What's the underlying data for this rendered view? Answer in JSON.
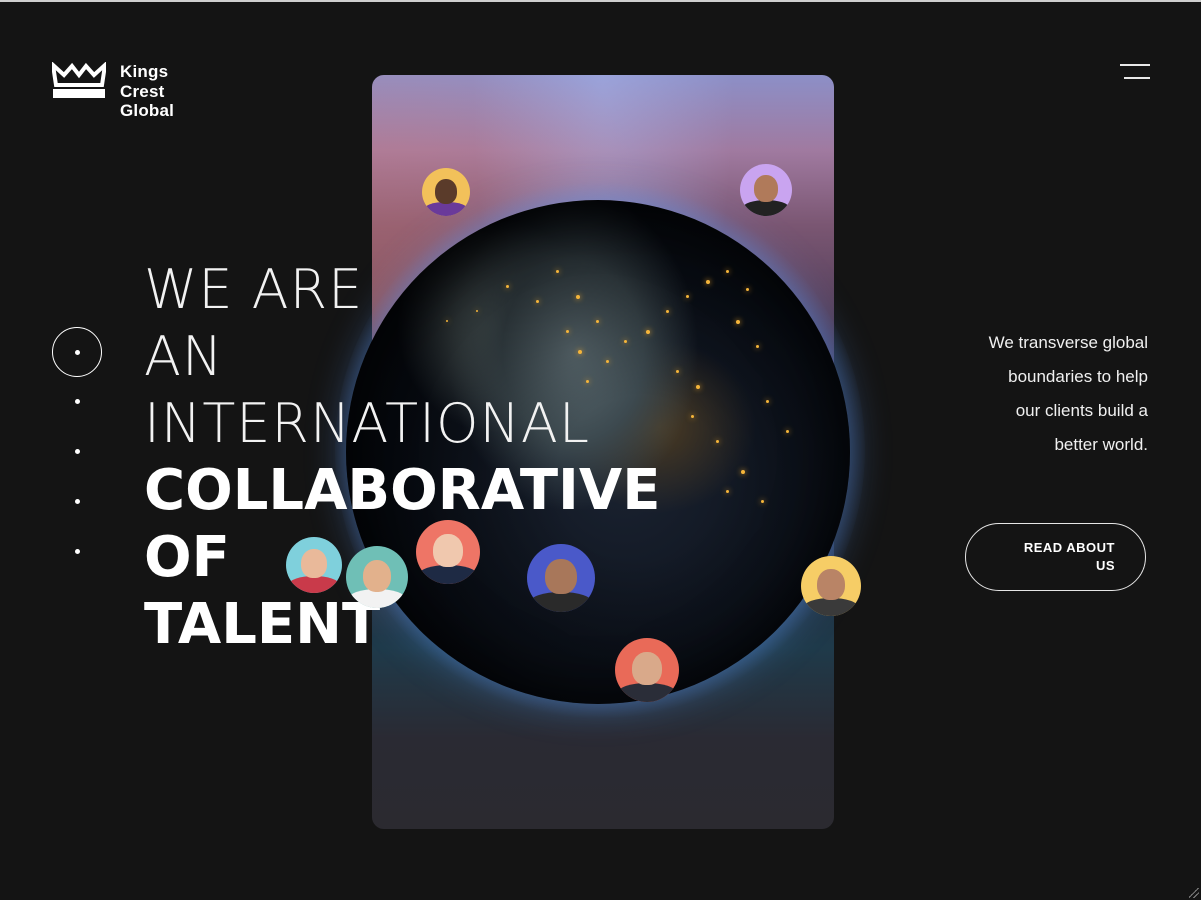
{
  "brand": {
    "name_line1": "Kings",
    "name_line2": "Crest",
    "name_line3": "Global"
  },
  "hero": {
    "line1": "WE ARE",
    "line2": "AN",
    "line3": "INTERNATIONAL",
    "line4": "COLLABORATIVE",
    "line5": "OF",
    "line6": "TALENT"
  },
  "side": {
    "tagline_1": "We transverse global",
    "tagline_2": "boundaries to help",
    "tagline_3": "our clients build a",
    "tagline_4": "better world.",
    "cta_label": "READ ABOUT US"
  },
  "pager": {
    "total": 5,
    "active_index": 0
  },
  "icons": {
    "logo": "crown-icon",
    "menu": "hamburger-menu-icon"
  },
  "colors": {
    "background": "#141414",
    "text": "#ffffff",
    "avatar_backgrounds": [
      "#f2c15a",
      "#c9a4f0",
      "#7fd0dc",
      "#6fbfb6",
      "#ee7566",
      "#4a59c9",
      "#f6cd66",
      "#e96a58"
    ]
  }
}
